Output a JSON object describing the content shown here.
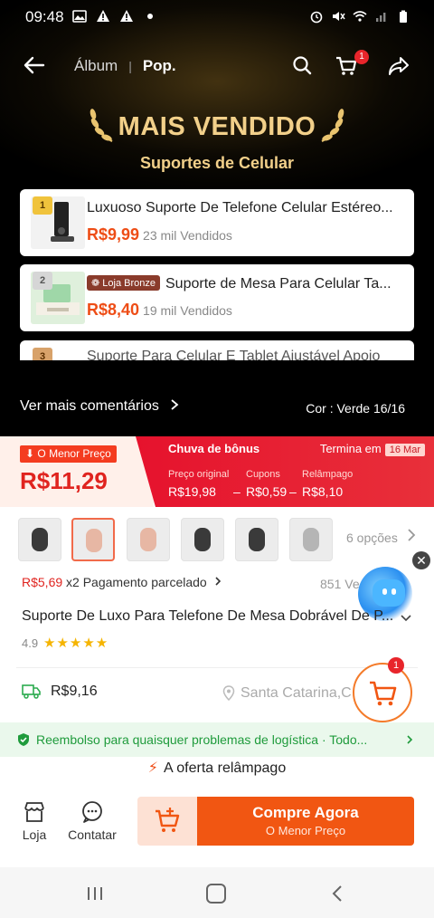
{
  "status_bar": {
    "time": "09:48"
  },
  "nav": {
    "tab_album": "Álbum",
    "separator": "|",
    "tab_pop": "Pop.",
    "cart_badge": "1"
  },
  "bestseller": {
    "title": "MAIS VENDIDO",
    "subtitle": "Suportes de Celular",
    "items": [
      {
        "rank": "1",
        "title": "Luxuoso Suporte De Telefone Celular Estéreo...",
        "price": "R$9,99",
        "sold": "23 mil Vendidos",
        "store_badge": ""
      },
      {
        "rank": "2",
        "title": "Suporte de Mesa Para Celular Ta...",
        "price": "R$8,40",
        "sold": "19 mil Vendidos",
        "store_badge": "Loja Bronze"
      },
      {
        "rank": "3",
        "title": "Suporte Para Celular E Tablet Ajustável Apoio"
      }
    ],
    "more_comments": "Ver mais comentários",
    "color_info": "Cor : Verde   16/16"
  },
  "promo": {
    "lowest_tag": "O Menor Preço",
    "price": "R$11,29",
    "bonus_label": "Chuva de bônus",
    "ends_label": "Termina em",
    "ends_date": "16 Mar",
    "original_label": "Preço original",
    "original_value": "R$19,98",
    "coupons_label": "Cupons",
    "coupons_value": "R$0,59",
    "flash_label": "Relâmpago",
    "flash_value": "R$8,10",
    "minus": "–"
  },
  "variants": {
    "options_label": "6 opções"
  },
  "product": {
    "installment_price": "R$5,69",
    "installment_text": "x2 Pagamento parcelado",
    "sold": "851 Ve",
    "title": "Suporte De Luxo Para Telefone De Mesa Dobrável De P...",
    "rating": "4.9",
    "stars": "★★★★★",
    "shipping_price": "R$9,16",
    "location": "Santa Catarina,C",
    "float_cart_badge": "1"
  },
  "refund": {
    "text": "Reembolso para quaisquer problemas de logística · Todo..."
  },
  "flash": {
    "icon": "⚡",
    "text": "A oferta relâmpago"
  },
  "action_bar": {
    "store_label": "Loja",
    "contact_label": "Contatar",
    "buy_label": "Compre Agora",
    "buy_sub": "O Menor Preço"
  },
  "colors": {
    "accent": "#f15612",
    "gold": "#f2d08a",
    "promo_red": "#e6122d",
    "refund_green": "#1f9b3c"
  },
  "close_glyph": "✕"
}
